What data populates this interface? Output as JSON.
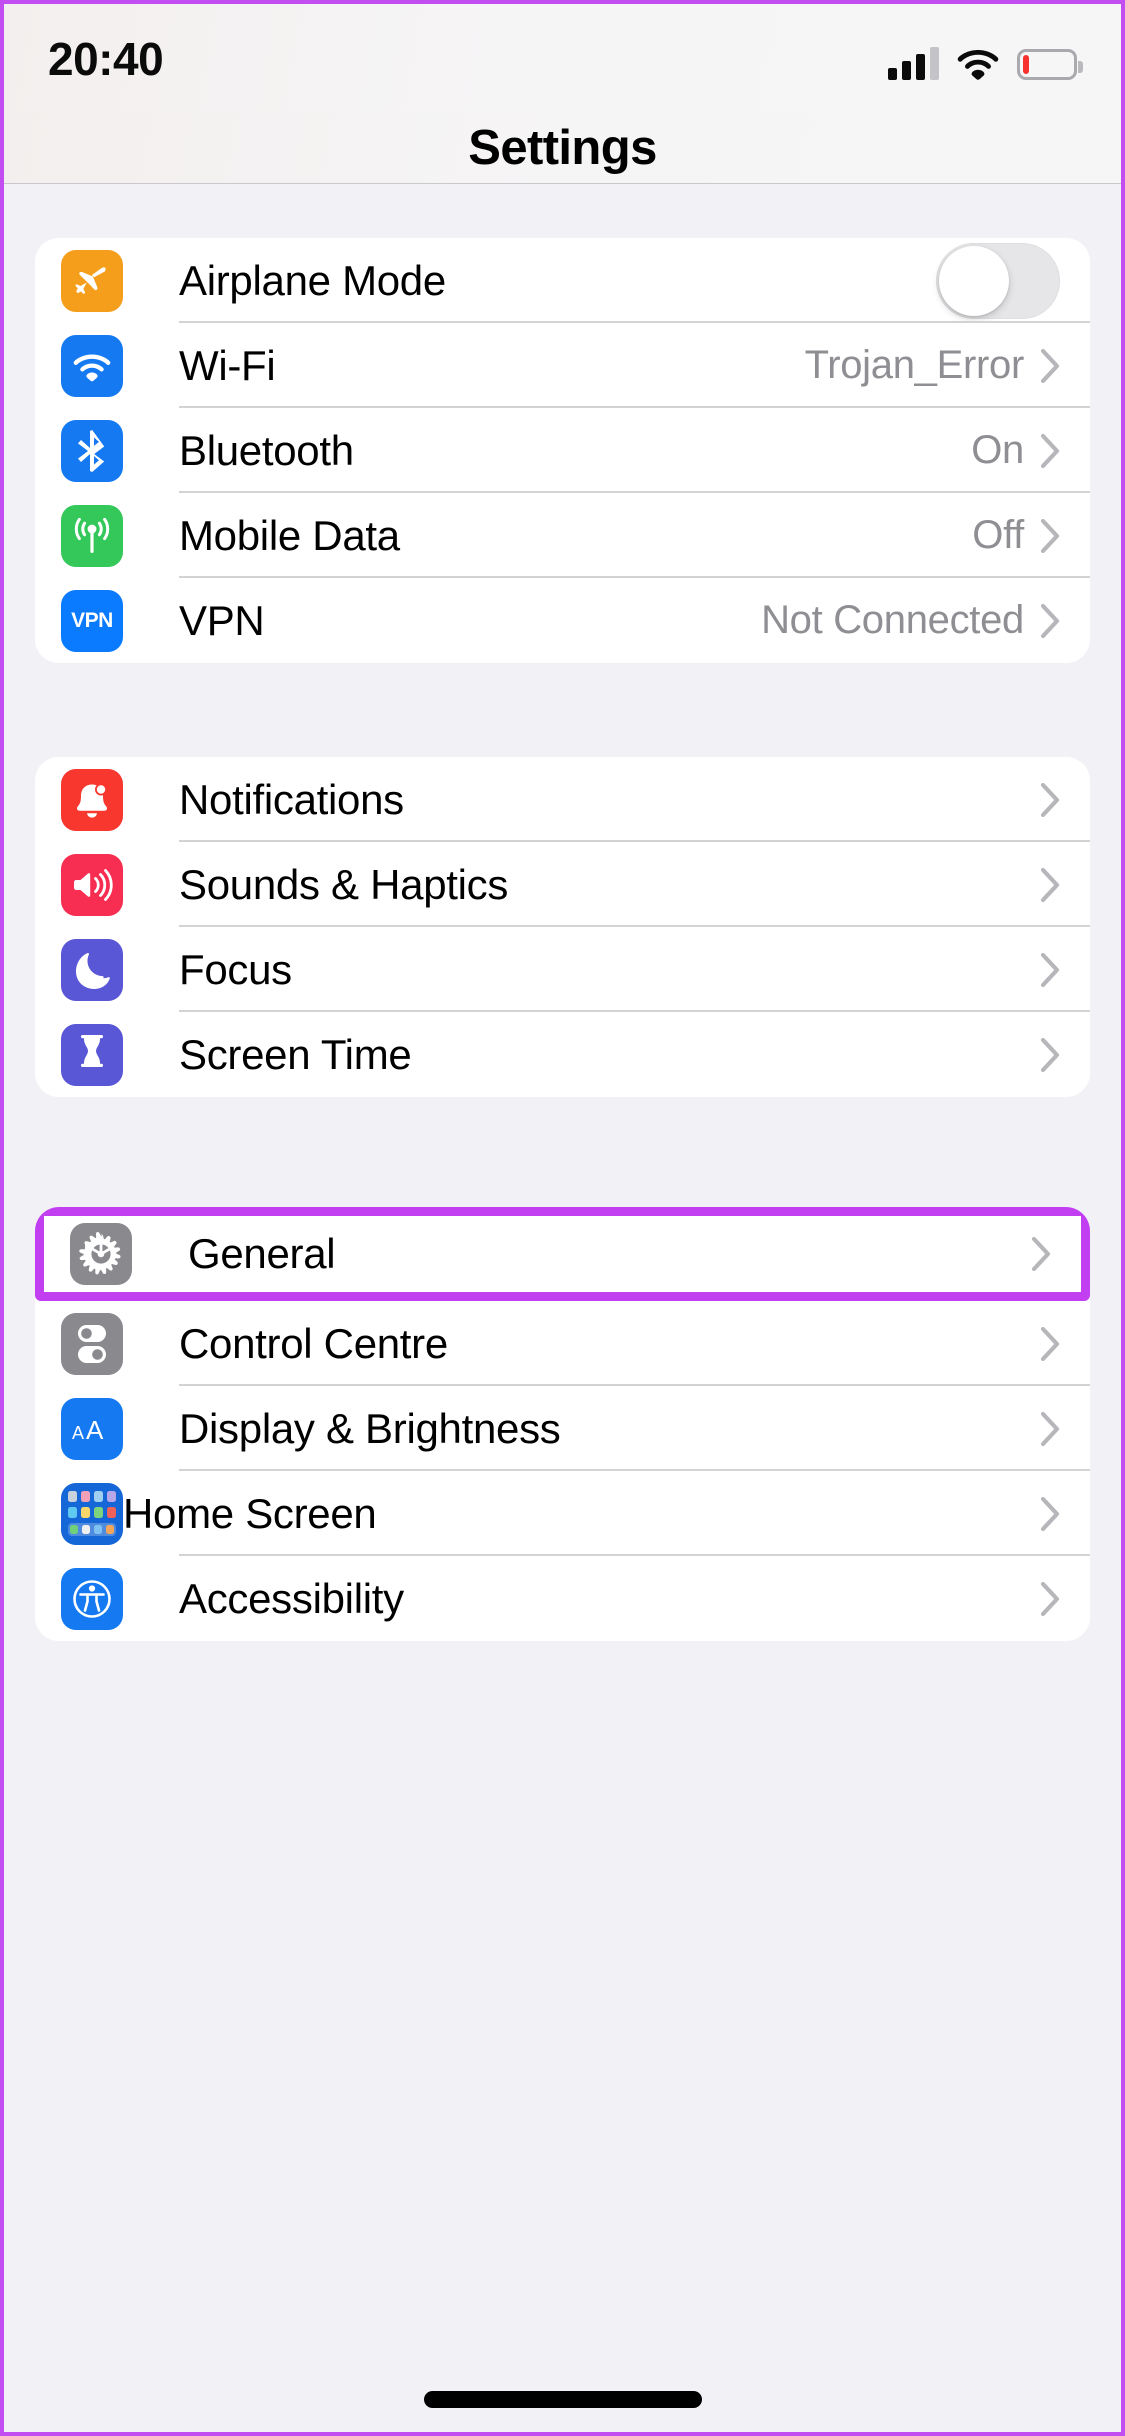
{
  "status_bar": {
    "time": "20:40",
    "signal_bars_filled": 3,
    "signal_bars_total": 4,
    "wifi": "wifi-icon",
    "battery_level_percent": 12,
    "battery_color": "#f8312f"
  },
  "nav": {
    "title": "Settings"
  },
  "highlight": {
    "color": "#c13ff0",
    "target_row": "General"
  },
  "sections": [
    {
      "rows": [
        {
          "label": "Airplane Mode",
          "icon": "airplane-icon",
          "icon_color": "#f59e1b",
          "control": "toggle",
          "toggle_on": false
        },
        {
          "label": "Wi-Fi",
          "icon": "wifi-icon",
          "icon_color": "#1579f2",
          "value": "Trojan_Error",
          "control": "chevron"
        },
        {
          "label": "Bluetooth",
          "icon": "bluetooth-icon",
          "icon_color": "#1579f2",
          "value": "On",
          "control": "chevron"
        },
        {
          "label": "Mobile Data",
          "icon": "cellular-icon",
          "icon_color": "#34c759",
          "value": "Off",
          "control": "chevron"
        },
        {
          "label": "VPN",
          "icon": "vpn-icon",
          "icon_color": "#0a7aff",
          "value": "Not Connected",
          "control": "chevron"
        }
      ]
    },
    {
      "rows": [
        {
          "label": "Notifications",
          "icon": "bell-icon",
          "icon_color": "#f8382f",
          "control": "chevron"
        },
        {
          "label": "Sounds & Haptics",
          "icon": "speaker-icon",
          "icon_color": "#f72e52",
          "control": "chevron"
        },
        {
          "label": "Focus",
          "icon": "moon-icon",
          "icon_color": "#5a57d6",
          "control": "chevron"
        },
        {
          "label": "Screen Time",
          "icon": "hourglass-icon",
          "icon_color": "#5a57d6",
          "control": "chevron"
        }
      ]
    },
    {
      "rows": [
        {
          "label": "General",
          "icon": "gear-icon",
          "icon_color": "#8a8a8e",
          "control": "chevron",
          "highlighted": true
        },
        {
          "label": "Control Centre",
          "icon": "control-centre-icon",
          "icon_color": "#8a8a8e",
          "control": "chevron"
        },
        {
          "label": "Display & Brightness",
          "icon": "display-brightness-icon",
          "icon_color": "#1579f2",
          "control": "chevron"
        },
        {
          "label": "Home Screen",
          "icon": "home-screen-icon",
          "icon_color": "#1566d6",
          "control": "chevron"
        },
        {
          "label": "Accessibility",
          "icon": "accessibility-icon",
          "icon_color": "#1579f2",
          "control": "chevron"
        }
      ]
    }
  ]
}
